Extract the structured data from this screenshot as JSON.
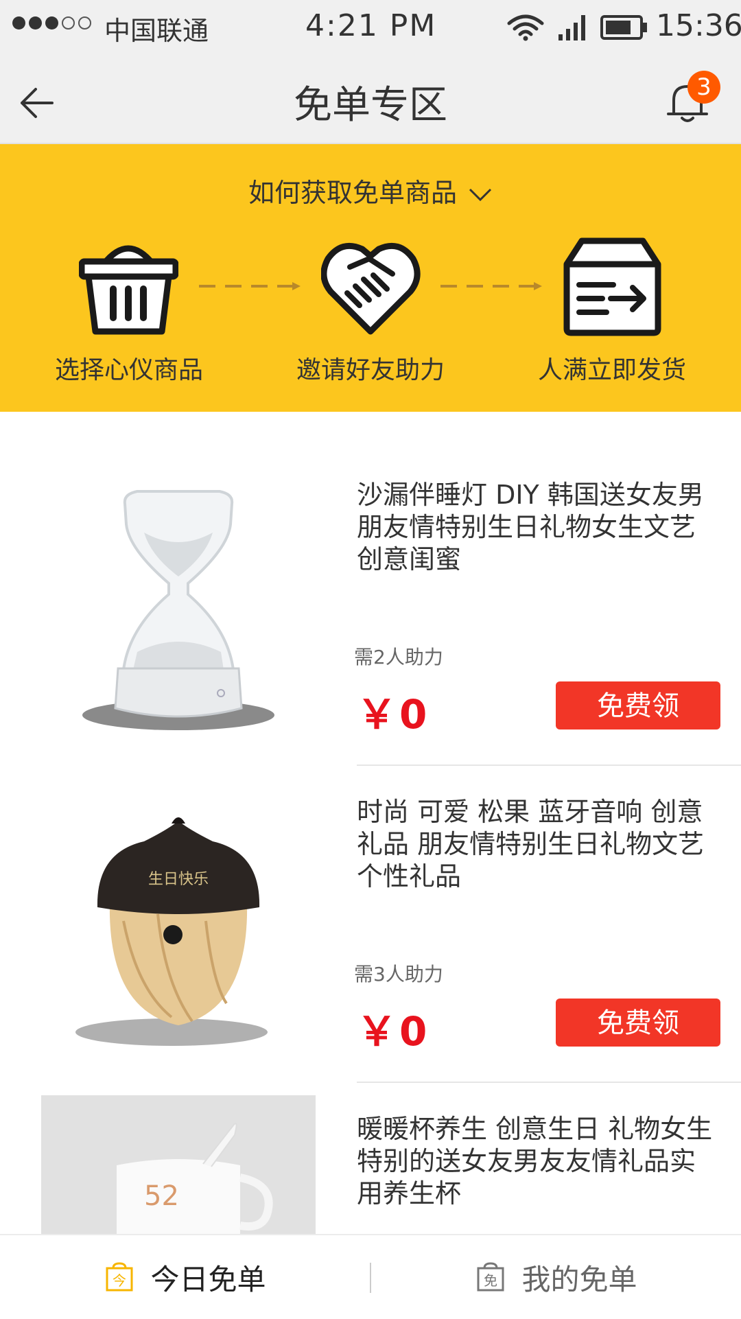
{
  "status_bar": {
    "signal_dots": "●●●○○",
    "carrier": "中国联通",
    "time": "4:21 PM",
    "clock": "15:36"
  },
  "nav": {
    "title": "免单专区",
    "badge_count": "3"
  },
  "banner": {
    "how_label": "如何获取免单商品",
    "steps": [
      {
        "label": "选择心仪商品",
        "icon": "basket-icon"
      },
      {
        "label": "邀请好友助力",
        "icon": "handshake-heart-icon"
      },
      {
        "label": "人满立即发货",
        "icon": "shipping-box-icon"
      }
    ]
  },
  "products": [
    {
      "title": "沙漏伴睡灯 DIY 韩国送女友男朋友情特别生日礼物女生文艺创意闺蜜",
      "need": "需2人助力",
      "price": "￥0",
      "button": "免费领"
    },
    {
      "title": "时尚  可爱 松果  蓝牙音响 创意礼品 朋友情特别生日礼物文艺个性礼品",
      "need": "需3人助力",
      "price": "￥0",
      "button": "免费领",
      "image_text": "生日快乐"
    },
    {
      "title": "暖暖杯养生  创意生日 礼物女生特别的送女友男友友情礼品实用养生杯",
      "image_text": "52"
    }
  ],
  "tabs": {
    "today": "今日免单",
    "mine": "我的免单",
    "today_icon_char": "今",
    "mine_icon_char": "免"
  },
  "colors": {
    "banner": "#fcc61e",
    "price": "#e8131e",
    "button": "#f23627",
    "badge": "#ff5a00"
  }
}
